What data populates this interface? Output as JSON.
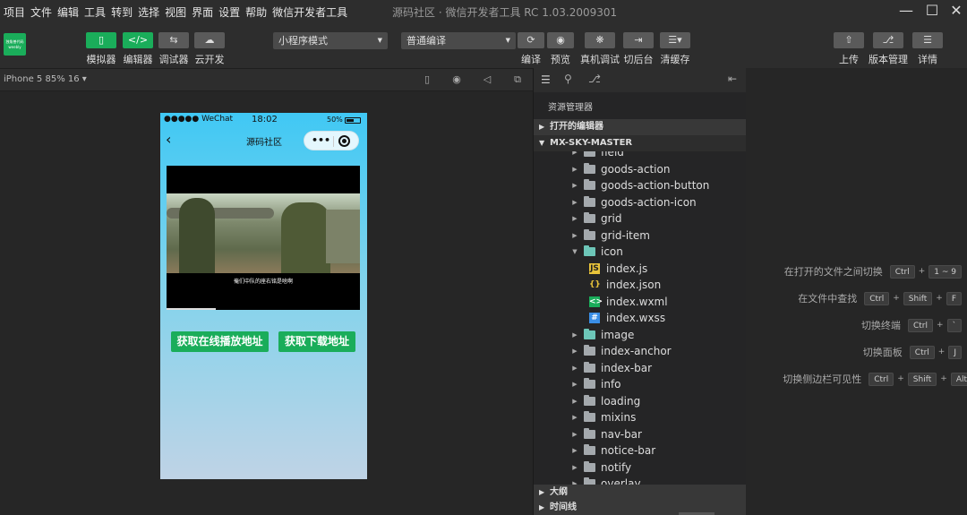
{
  "menubar": {
    "items": [
      "项目",
      "文件",
      "编辑",
      "工具",
      "转到",
      "选择",
      "视图",
      "界面",
      "设置",
      "帮助",
      "微信开发者工具"
    ],
    "title": "源码社区 · 微信开发者工具 RC 1.03.2009301"
  },
  "toolbar": {
    "logo_text": "独角兽代码 weebly",
    "left_buttons": [
      "模拟器",
      "编辑器",
      "调试器",
      "云开发"
    ],
    "mode_select": "小程序模式",
    "compile_select": "普通编译",
    "right_actions": [
      "编译",
      "预览",
      "真机调试",
      "切后台",
      "清缓存"
    ],
    "far_right": [
      "上传",
      "版本管理",
      "详情"
    ]
  },
  "simulator": {
    "device": "iPhone 5 85% 16 ▾"
  },
  "phone": {
    "status": {
      "carrier": "●●●●● WeChat",
      "time": "18:02",
      "battery": "50%"
    },
    "nav_title": "源码社区",
    "subtitle": "俺们中队的座右铭是啥啊",
    "buttons": [
      "获取在线播放地址",
      "获取下载地址"
    ]
  },
  "explorer": {
    "header": "资源管理器",
    "sections": {
      "open": "打开的编辑器",
      "project": "MX-SKY-MASTER",
      "outline": "大纲",
      "timeline": "时间线"
    },
    "tree": [
      {
        "name": "field",
        "type": "folder",
        "indent": 0,
        "open": false
      },
      {
        "name": "goods-action",
        "type": "folder",
        "indent": 0,
        "open": false
      },
      {
        "name": "goods-action-button",
        "type": "folder",
        "indent": 0,
        "open": false
      },
      {
        "name": "goods-action-icon",
        "type": "folder",
        "indent": 0,
        "open": false
      },
      {
        "name": "grid",
        "type": "folder",
        "indent": 0,
        "open": false
      },
      {
        "name": "grid-item",
        "type": "folder",
        "indent": 0,
        "open": false
      },
      {
        "name": "icon",
        "type": "folder-teal",
        "indent": 0,
        "open": true
      },
      {
        "name": "index.js",
        "type": "js",
        "indent": 1
      },
      {
        "name": "index.json",
        "type": "json",
        "indent": 1
      },
      {
        "name": "index.wxml",
        "type": "wxml",
        "indent": 1
      },
      {
        "name": "index.wxss",
        "type": "wxss",
        "indent": 1
      },
      {
        "name": "image",
        "type": "folder-teal",
        "indent": 0,
        "open": false
      },
      {
        "name": "index-anchor",
        "type": "folder",
        "indent": 0,
        "open": false
      },
      {
        "name": "index-bar",
        "type": "folder",
        "indent": 0,
        "open": false
      },
      {
        "name": "info",
        "type": "folder",
        "indent": 0,
        "open": false
      },
      {
        "name": "loading",
        "type": "folder",
        "indent": 0,
        "open": false
      },
      {
        "name": "mixins",
        "type": "folder",
        "indent": 0,
        "open": false
      },
      {
        "name": "nav-bar",
        "type": "folder",
        "indent": 0,
        "open": false
      },
      {
        "name": "notice-bar",
        "type": "folder",
        "indent": 0,
        "open": false
      },
      {
        "name": "notify",
        "type": "folder",
        "indent": 0,
        "open": false
      },
      {
        "name": "overlay",
        "type": "folder",
        "indent": 0,
        "open": false
      }
    ]
  },
  "shortcuts": [
    {
      "label": "在打开的文件之间切换",
      "keys": [
        "Ctrl",
        "1 ~ 9"
      ]
    },
    {
      "label": "在文件中查找",
      "keys": [
        "Ctrl",
        "Shift",
        "F"
      ]
    },
    {
      "label": "切换终端",
      "keys": [
        "Ctrl",
        "`"
      ]
    },
    {
      "label": "切换面板",
      "keys": [
        "Ctrl",
        "J"
      ]
    },
    {
      "label": "切换侧边栏可见性",
      "keys": [
        "Ctrl",
        "Shift",
        "Alt"
      ]
    }
  ]
}
